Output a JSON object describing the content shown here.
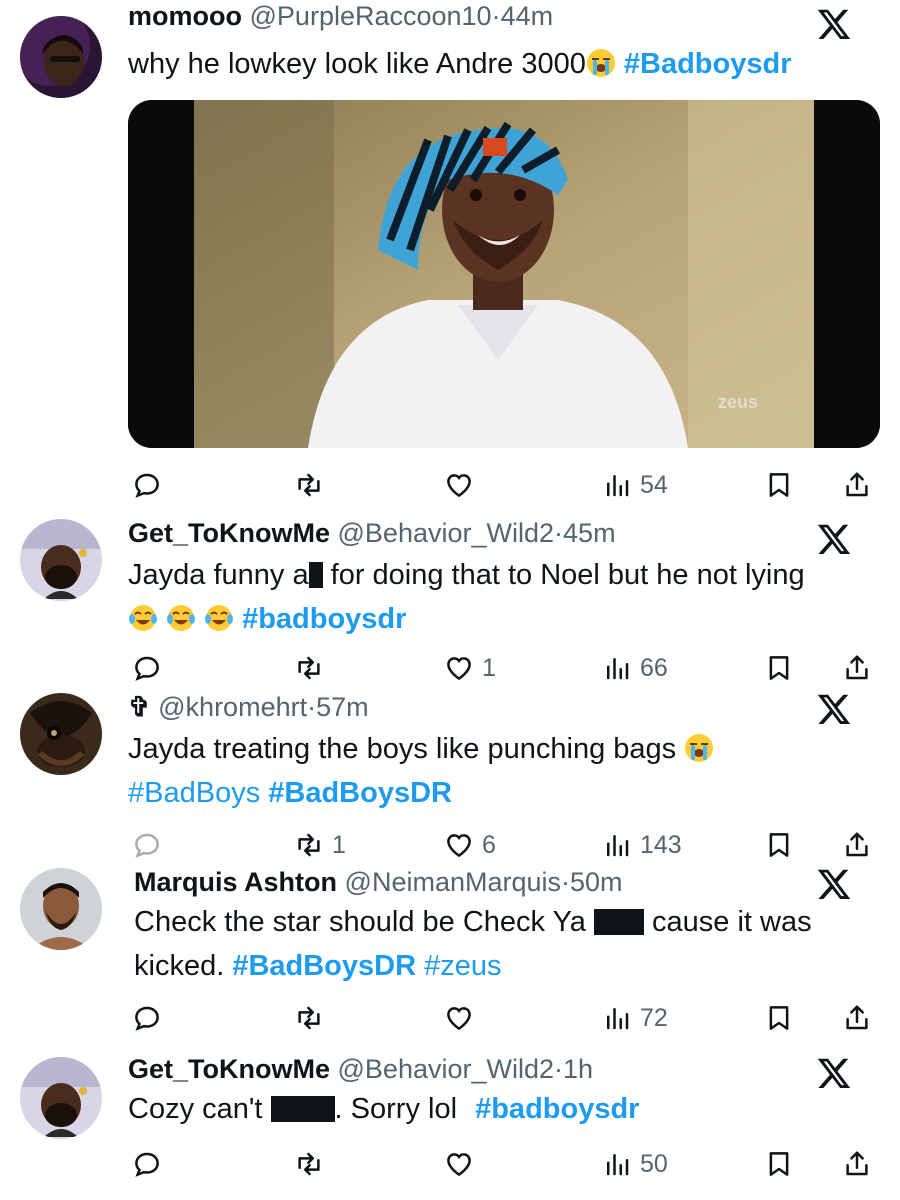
{
  "tweets": [
    {
      "name": "momooo",
      "handle": "@PurpleRaccoon10",
      "sep": "·",
      "time": "44m",
      "line1": "why he lowkey look like Andre 3000",
      "tag1": "#Badboysdr",
      "media_watermark": "zeus",
      "replies": "",
      "retweets": "",
      "likes": "",
      "views": "54"
    },
    {
      "name": "Get_ToKnowMe",
      "handle": "@Behavior_Wild2",
      "sep": "·",
      "time": "45m",
      "line1a": "Jayda funny a",
      "line1b": " for doing that to Noel but he not lying",
      "tag1": "#badboysdr",
      "replies": "",
      "retweets": "",
      "likes": "1",
      "views": "66"
    },
    {
      "name": "",
      "name_glyph": "✞",
      "handle": "@khromehrt",
      "sep": "·",
      "time": "57m",
      "line1": "Jayda treating the boys like punching bags",
      "tag1": "#BadBoys",
      "tag2": "#BadBoysDR",
      "replies": "",
      "retweets": "1",
      "likes": "6",
      "views": "143"
    },
    {
      "name": "Marquis Ashton",
      "handle": "@NeimanMarquis",
      "sep": "·",
      "time": "50m",
      "line1a": "Check the star should be Check Ya ",
      "line1b": " cause it was",
      "line2": "kicked.",
      "tag1": "#BadBoysDR",
      "tag2": "#zeus",
      "replies": "",
      "retweets": "",
      "likes": "",
      "views": "72"
    },
    {
      "name": "Get_ToKnowMe",
      "handle": "@Behavior_Wild2",
      "sep": "·",
      "time": "1h",
      "line1a": "Cozy can't ",
      "line1b": ". Sorry lol",
      "tag1": "#badboysdr",
      "replies": "",
      "retweets": "",
      "likes": "",
      "views": "50"
    }
  ],
  "colors": {
    "link": "#1d9bf0",
    "muted": "#536471",
    "text": "#0f1419"
  },
  "icons": [
    "reply-icon",
    "retweet-icon",
    "like-icon",
    "views-icon",
    "bookmark-icon",
    "share-icon",
    "x-logo-icon",
    "loudly-crying-emoji",
    "tears-of-joy-emoji"
  ]
}
